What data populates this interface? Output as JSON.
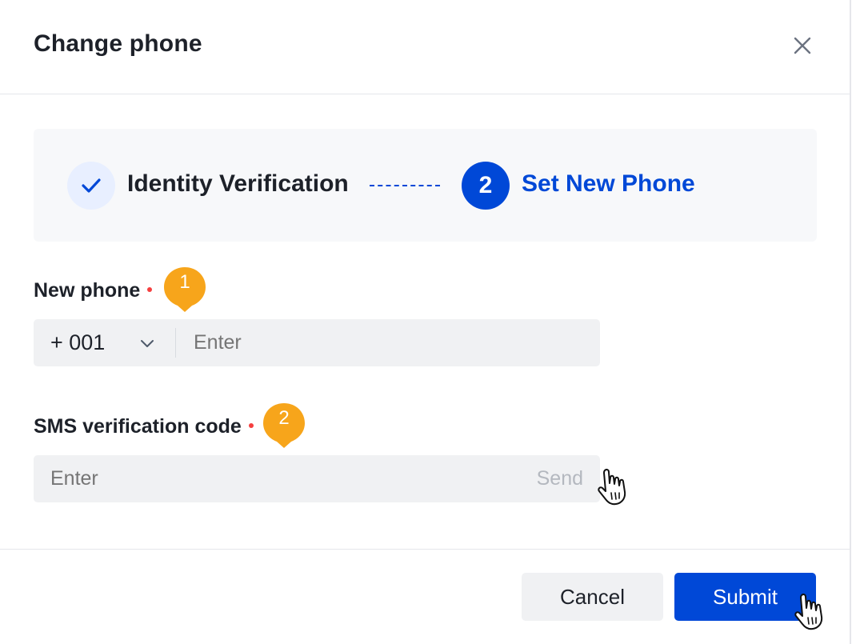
{
  "dialog": {
    "title": "Change phone",
    "close_icon": "close-icon"
  },
  "steps": [
    {
      "label": "Identity Verification",
      "status": "done",
      "icon": "check-icon"
    },
    {
      "label": "Set New Phone",
      "number": "2",
      "status": "active"
    }
  ],
  "form": {
    "phone": {
      "label": "New phone",
      "required": true,
      "badge": "1",
      "country_code": "+ 001",
      "placeholder": "Enter"
    },
    "sms": {
      "label": "SMS verification code",
      "required": true,
      "badge": "2",
      "placeholder": "Enter",
      "send_label": "Send"
    }
  },
  "footer": {
    "cancel_label": "Cancel",
    "submit_label": "Submit"
  },
  "colors": {
    "primary": "#0048d7",
    "badge": "#f7a51b",
    "required": "#f53f3f",
    "field_bg": "#f0f1f3"
  }
}
